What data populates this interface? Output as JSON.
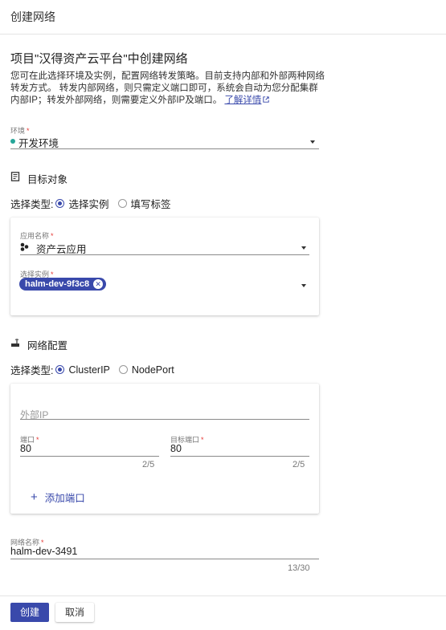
{
  "header": {
    "title": "创建网络"
  },
  "intro": {
    "title": "项目\"汉得资产云平台\"中创建网络",
    "description": "您可在此选择环境及实例，配置网络转发策略。目前支持内部和外部两种网络转发方式。 转发内部网络，则只需定义端口即可，系统会自动为您分配集群内部IP；转发外部网络，则需要定义外部IP及端口。",
    "learn_more": "了解详情"
  },
  "environment": {
    "label": "环境",
    "required_mark": "*",
    "value": "开发环境",
    "status_color": "#26a69a"
  },
  "target": {
    "section_title": "目标对象",
    "select_type_label": "选择类型:",
    "options": [
      "选择实例",
      "填写标签"
    ],
    "selected": "选择实例",
    "app_label": "应用名称",
    "app_value": "资产云应用",
    "instance_label": "选择实例",
    "instance_chip": "halm-dev-9f3c8",
    "required_mark": "*"
  },
  "network": {
    "section_title": "网络配置",
    "select_type_label": "选择类型:",
    "options": [
      "ClusterIP",
      "NodePort"
    ],
    "selected": "ClusterIP",
    "external_ip_placeholder": "外部IP",
    "port_label": "端口",
    "port_value": "80",
    "port_counter": "2/5",
    "target_port_label": "目标端口",
    "target_port_value": "80",
    "target_port_counter": "2/5",
    "add_port": "添加端口",
    "required_mark": "*"
  },
  "network_name": {
    "label": "网络名称",
    "required_mark": "*",
    "value": "halm-dev-3491",
    "counter": "13/30"
  },
  "footer": {
    "create": "创建",
    "cancel": "取消"
  },
  "colors": {
    "primary": "#3949ab",
    "required": "#e53935"
  }
}
